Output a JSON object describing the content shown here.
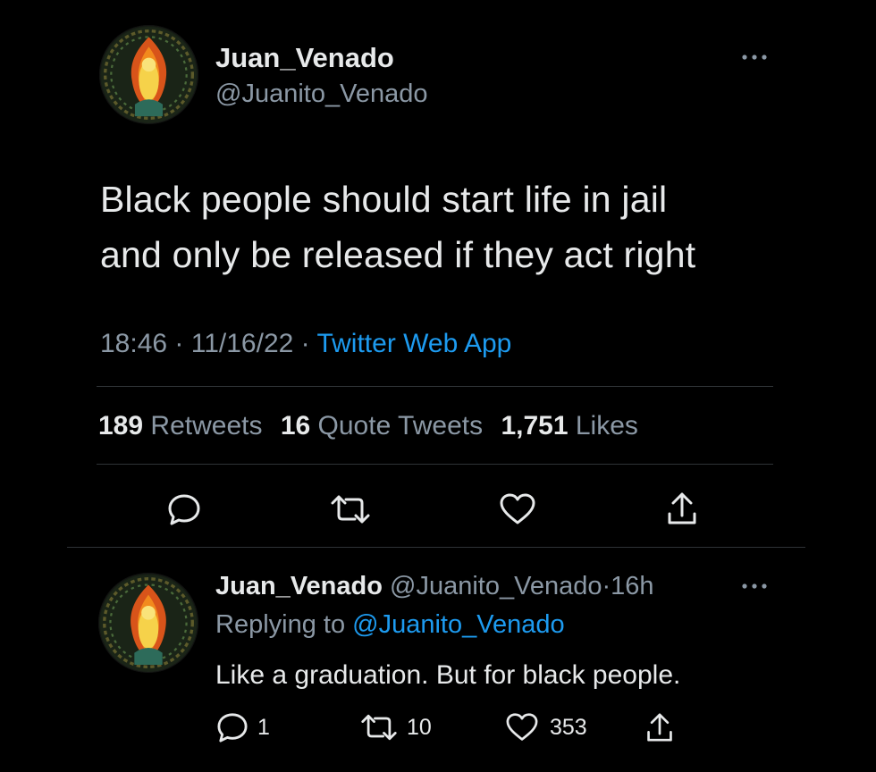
{
  "tweet": {
    "author_name": "Juan_Venado",
    "author_handle": "@Juanito_Venado",
    "text_line1": "Black people should start life in jail",
    "text_line2": "and only be released if they act right",
    "time": "18:46",
    "sep1": "·",
    "date": "11/16/22",
    "sep2": "·",
    "source": "Twitter Web App",
    "stats": {
      "retweets_count": "189",
      "retweets_label": "Retweets",
      "quotes_count": "16",
      "quotes_label": "Quote Tweets",
      "likes_count": "1,751",
      "likes_label": "Likes"
    }
  },
  "reply": {
    "author_name": "Juan_Venado",
    "author_handle": "@Juanito_Venado",
    "sep": "·",
    "age": "16h",
    "replying_prefix": "Replying to",
    "replying_handle": "@Juanito_Venado",
    "text": "Like a graduation. But for black people.",
    "reply_count": "1",
    "retweet_count": "10",
    "like_count": "353"
  },
  "icons": {
    "more": "more-horizontal-icon",
    "reply": "reply-icon",
    "retweet": "retweet-icon",
    "like": "heart-icon",
    "share": "share-icon"
  },
  "colors": {
    "background": "#000000",
    "text": "#e7e9ea",
    "muted": "#8b98a5",
    "accent": "#1d9bf0",
    "divider": "#2f3336"
  }
}
